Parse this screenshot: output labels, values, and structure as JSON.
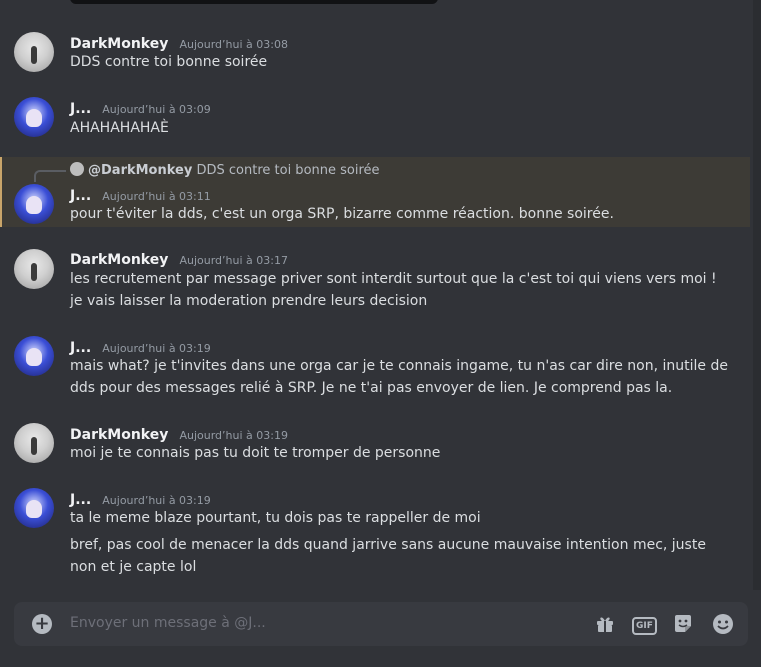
{
  "messages": [
    {
      "author": "DarkMonkey",
      "timestamp": "Aujourd’hui à 03:08",
      "lines": [
        "DDS contre toi bonne soirée"
      ]
    },
    {
      "author": "J...",
      "timestamp": "Aujourd’hui à 03:09",
      "lines": [
        "AHAHAHAHAÈ"
      ]
    },
    {
      "author": "J...",
      "timestamp": "Aujourd’hui à 03:11",
      "reply": {
        "mention": "@DarkMonkey",
        "text": "DDS contre toi bonne soirée"
      },
      "lines": [
        "pour t'éviter la dds, c'est un orga SRP, bizarre comme réaction. bonne soirée."
      ]
    },
    {
      "author": "DarkMonkey",
      "timestamp": "Aujourd’hui à 03:17",
      "lines": [
        "les recrutement par message priver sont interdit surtout que la c'est toi qui viens vers moi !",
        "je vais laisser la moderation prendre leurs decision"
      ]
    },
    {
      "author": "J...",
      "timestamp": "Aujourd’hui à 03:19",
      "lines": [
        "mais what? je t'invites dans une orga car je te connais ingame, tu n'as car dire non, inutile de",
        "dds pour des messages relié à SRP. Je ne t'ai pas envoyer de lien. Je comprend pas la."
      ]
    },
    {
      "author": "DarkMonkey",
      "timestamp": "Aujourd’hui à 03:19",
      "lines": [
        "moi je te connais pas tu doit te tromper de personne"
      ]
    },
    {
      "author": "J...",
      "timestamp": "Aujourd’hui à 03:19",
      "lines": [
        "ta le meme blaze pourtant, tu dois pas te rappeller de moi"
      ]
    },
    {
      "author": "",
      "timestamp": "",
      "lines": [
        "bref, pas cool de menacer la dds quand jarrive sans aucune mauvaise intention mec, juste",
        "non et je capte lol"
      ]
    }
  ],
  "composer": {
    "placeholder": "Envoyer un message à @J...",
    "icons": [
      "plus-icon",
      "gift-icon",
      "gif-icon",
      "sticker-icon",
      "emoji-icon"
    ],
    "gif_label": "GIF"
  },
  "colors": {
    "background": "#313338",
    "reply_highlight": "#3d3b36",
    "reply_accent": "#c9a56a",
    "composer": "#383a40"
  }
}
